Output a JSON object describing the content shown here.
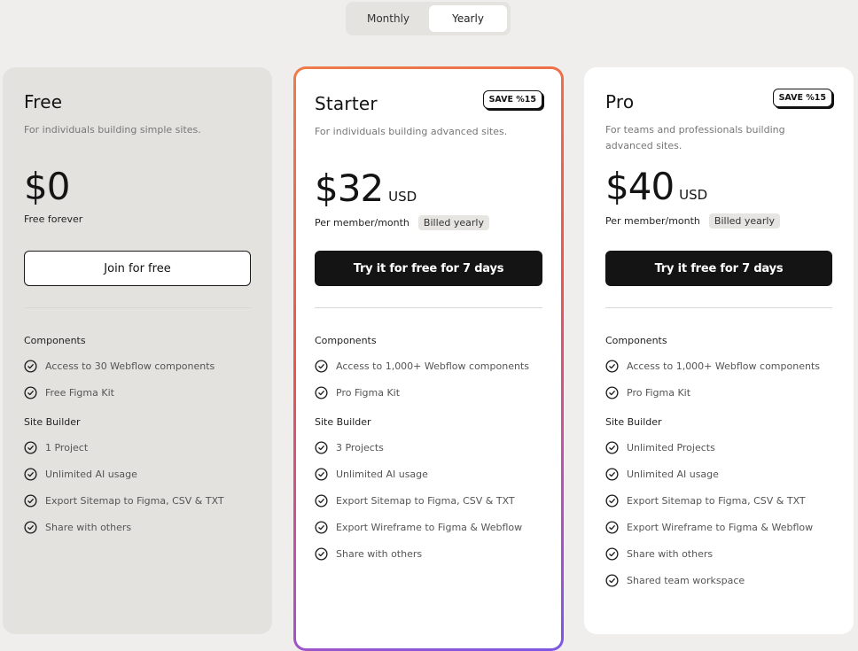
{
  "billing_toggle": {
    "options": [
      "Monthly",
      "Yearly"
    ],
    "selected": "Yearly"
  },
  "plans": [
    {
      "name": "Free",
      "description": "For individuals building simple sites.",
      "price": "$0",
      "currency": "",
      "price_note": "Free forever",
      "billed_badge": "",
      "save_badge": "",
      "cta": "Join for free",
      "sections": [
        {
          "title": "Components",
          "features": [
            "Access to 30 Webflow components",
            "Free Figma Kit"
          ]
        },
        {
          "title": "Site Builder",
          "features": [
            "1 Project",
            "Unlimited AI usage",
            "Export Sitemap to Figma, CSV & TXT",
            "Share with others"
          ]
        }
      ]
    },
    {
      "name": "Starter",
      "description": "For individuals building advanced sites.",
      "price": "$32",
      "currency": "USD",
      "price_note": "Per member/month",
      "billed_badge": "Billed yearly",
      "save_badge": "SAVE %15",
      "cta": "Try it for free for 7 days",
      "highlighted": true,
      "sections": [
        {
          "title": "Components",
          "features": [
            "Access to 1,000+ Webflow components",
            "Pro Figma Kit"
          ]
        },
        {
          "title": "Site Builder",
          "features": [
            "3 Projects",
            "Unlimited AI usage",
            "Export Sitemap to Figma, CSV & TXT",
            "Export Wireframe to Figma & Webflow",
            "Share with others"
          ]
        }
      ]
    },
    {
      "name": "Pro",
      "description": "For teams and professionals building advanced sites.",
      "price": "$40",
      "currency": "USD",
      "price_note": "Per member/month",
      "billed_badge": "Billed yearly",
      "save_badge": "SAVE %15",
      "cta": "Try it free for 7 days",
      "sections": [
        {
          "title": "Components",
          "features": [
            "Access to 1,000+ Webflow components",
            "Pro Figma Kit"
          ]
        },
        {
          "title": "Site Builder",
          "features": [
            "Unlimited Projects",
            "Unlimited AI usage",
            "Export Sitemap to Figma, CSV & TXT",
            "Export Wireframe to Figma & Webflow",
            "Share with others",
            "Shared team workspace"
          ]
        }
      ]
    }
  ],
  "colors": {
    "page_bg": "#efeeec",
    "free_card_bg": "#e3e2df",
    "cta_dark": "#141414",
    "gradient_start": "#ef7b4a",
    "gradient_mid": "#e9564e",
    "gradient_end": "#7b57e6"
  }
}
